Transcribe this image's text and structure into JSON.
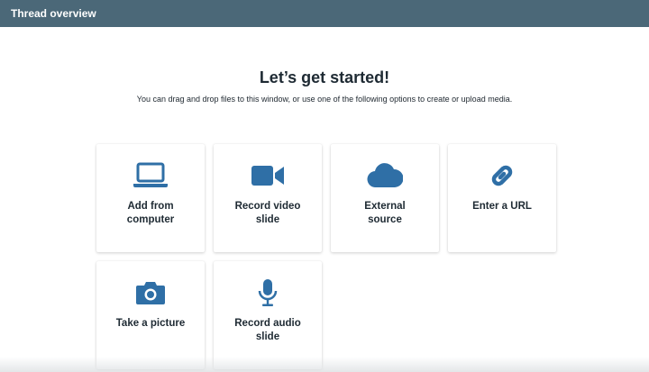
{
  "window": {
    "title": "Thread overview"
  },
  "intro": {
    "heading": "Let’s get started!",
    "subtitle": "You can drag and drop files to this window, or use one of the following options to create or upload media."
  },
  "colors": {
    "topbar": "#4b6878",
    "icon": "#2f6fa6",
    "text": "#1e2a33"
  },
  "options": [
    {
      "label": "Add from\ncomputer",
      "icon": "laptop-icon"
    },
    {
      "label": "Record video\nslide",
      "icon": "video-camera-icon"
    },
    {
      "label": "External\nsource",
      "icon": "cloud-icon"
    },
    {
      "label": "Enter a URL",
      "icon": "link-icon"
    },
    {
      "label": "Take a picture",
      "icon": "camera-icon"
    },
    {
      "label": "Record audio\nslide",
      "icon": "microphone-icon"
    }
  ]
}
